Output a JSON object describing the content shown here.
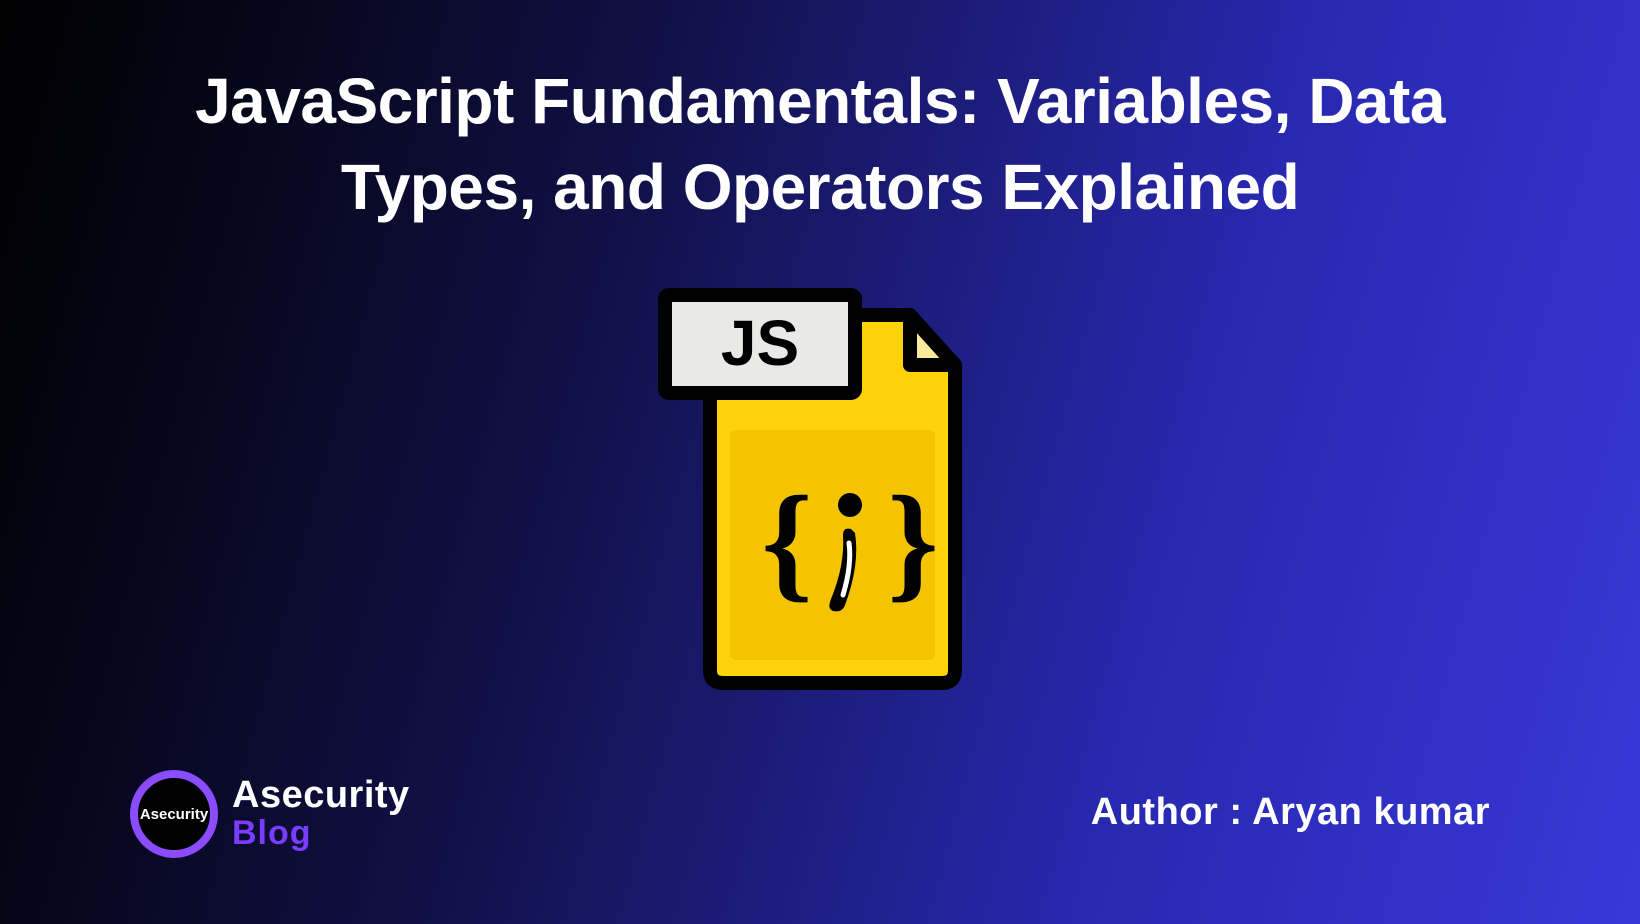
{
  "title": "JavaScript Fundamentals: Variables, Data Types, and Operators Explained",
  "icon": {
    "label": "JS",
    "body_glyph": "{i}"
  },
  "logo": {
    "ring_text": "Asecurity",
    "top": "Asecurity",
    "bottom": "Blog"
  },
  "author": {
    "prefix": "Author : ",
    "name": "Aryan kumar"
  },
  "colors": {
    "bg_dark": "#000000",
    "bg_blue": "#2828b0",
    "file_yellow": "#ffd20a",
    "file_yellow_light": "#ffe680",
    "label_bg": "#e9e9e8",
    "outline": "#000000",
    "logo_ring": "#8b4cff",
    "logo_sub": "#7a3cff",
    "text": "#ffffff"
  }
}
